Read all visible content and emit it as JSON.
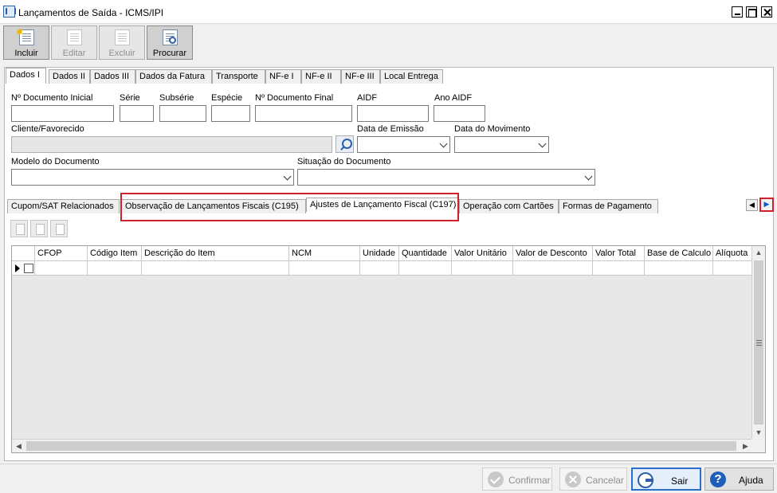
{
  "window": {
    "title": "Lançamentos de Saída - ICMS/IPI"
  },
  "toolbar": {
    "buttons": [
      {
        "label": "Incluir",
        "icon": "new-document-icon",
        "enabled": true
      },
      {
        "label": "Editar",
        "icon": "edit-document-icon",
        "enabled": false
      },
      {
        "label": "Excluir",
        "icon": "delete-document-icon",
        "enabled": false
      },
      {
        "label": "Procurar",
        "icon": "search-document-icon",
        "enabled": true
      }
    ]
  },
  "main_tabs": [
    {
      "label": "Dados I",
      "active": true
    },
    {
      "label": "Dados II"
    },
    {
      "label": "Dados III"
    },
    {
      "label": "Dados da Fatura"
    },
    {
      "label": "Transporte"
    },
    {
      "label": "NF-e I"
    },
    {
      "label": "NF-e II"
    },
    {
      "label": "NF-e III"
    },
    {
      "label": "Local Entrega"
    }
  ],
  "form": {
    "doc_inicial_label": "Nº Documento Inicial",
    "serie_label": "Série",
    "subserie_label": "Subsérie",
    "especie_label": "Espécie",
    "doc_final_label": "Nº Documento Final",
    "aidf_label": "AIDF",
    "ano_aidf_label": "Ano AIDF",
    "cliente_label": "Cliente/Favorecido",
    "data_emissao_label": "Data de Emissão",
    "data_movimento_label": "Data do Movimento",
    "modelo_label": "Modelo do Documento",
    "situacao_label": "Situação do Documento"
  },
  "sub_tabs": [
    {
      "label": "Cupom/SAT Relacionados"
    },
    {
      "label": "Observação de Lançamentos Fiscais (C195)",
      "highlighted": true
    },
    {
      "label": "Ajustes de Lançamento Fiscal (C197)",
      "active": true,
      "highlighted": true
    },
    {
      "label": "Operação com Cartões"
    },
    {
      "label": "Formas de Pagamento"
    }
  ],
  "grid": {
    "columns": [
      "",
      "CFOP",
      "Código Item",
      "Descrição do Item",
      "NCM",
      "Unidade",
      "Quantidade",
      "Valor Unitário",
      "Valor de Desconto",
      "Valor Total",
      "Base de Calculo",
      "Alíquota"
    ]
  },
  "footer": {
    "confirmar": "Confirmar",
    "cancelar": "Cancelar",
    "sair": "Sair",
    "ajuda": "Ajuda"
  },
  "colors": {
    "highlight": "#d0202c",
    "accent": "#2a6fc9"
  }
}
